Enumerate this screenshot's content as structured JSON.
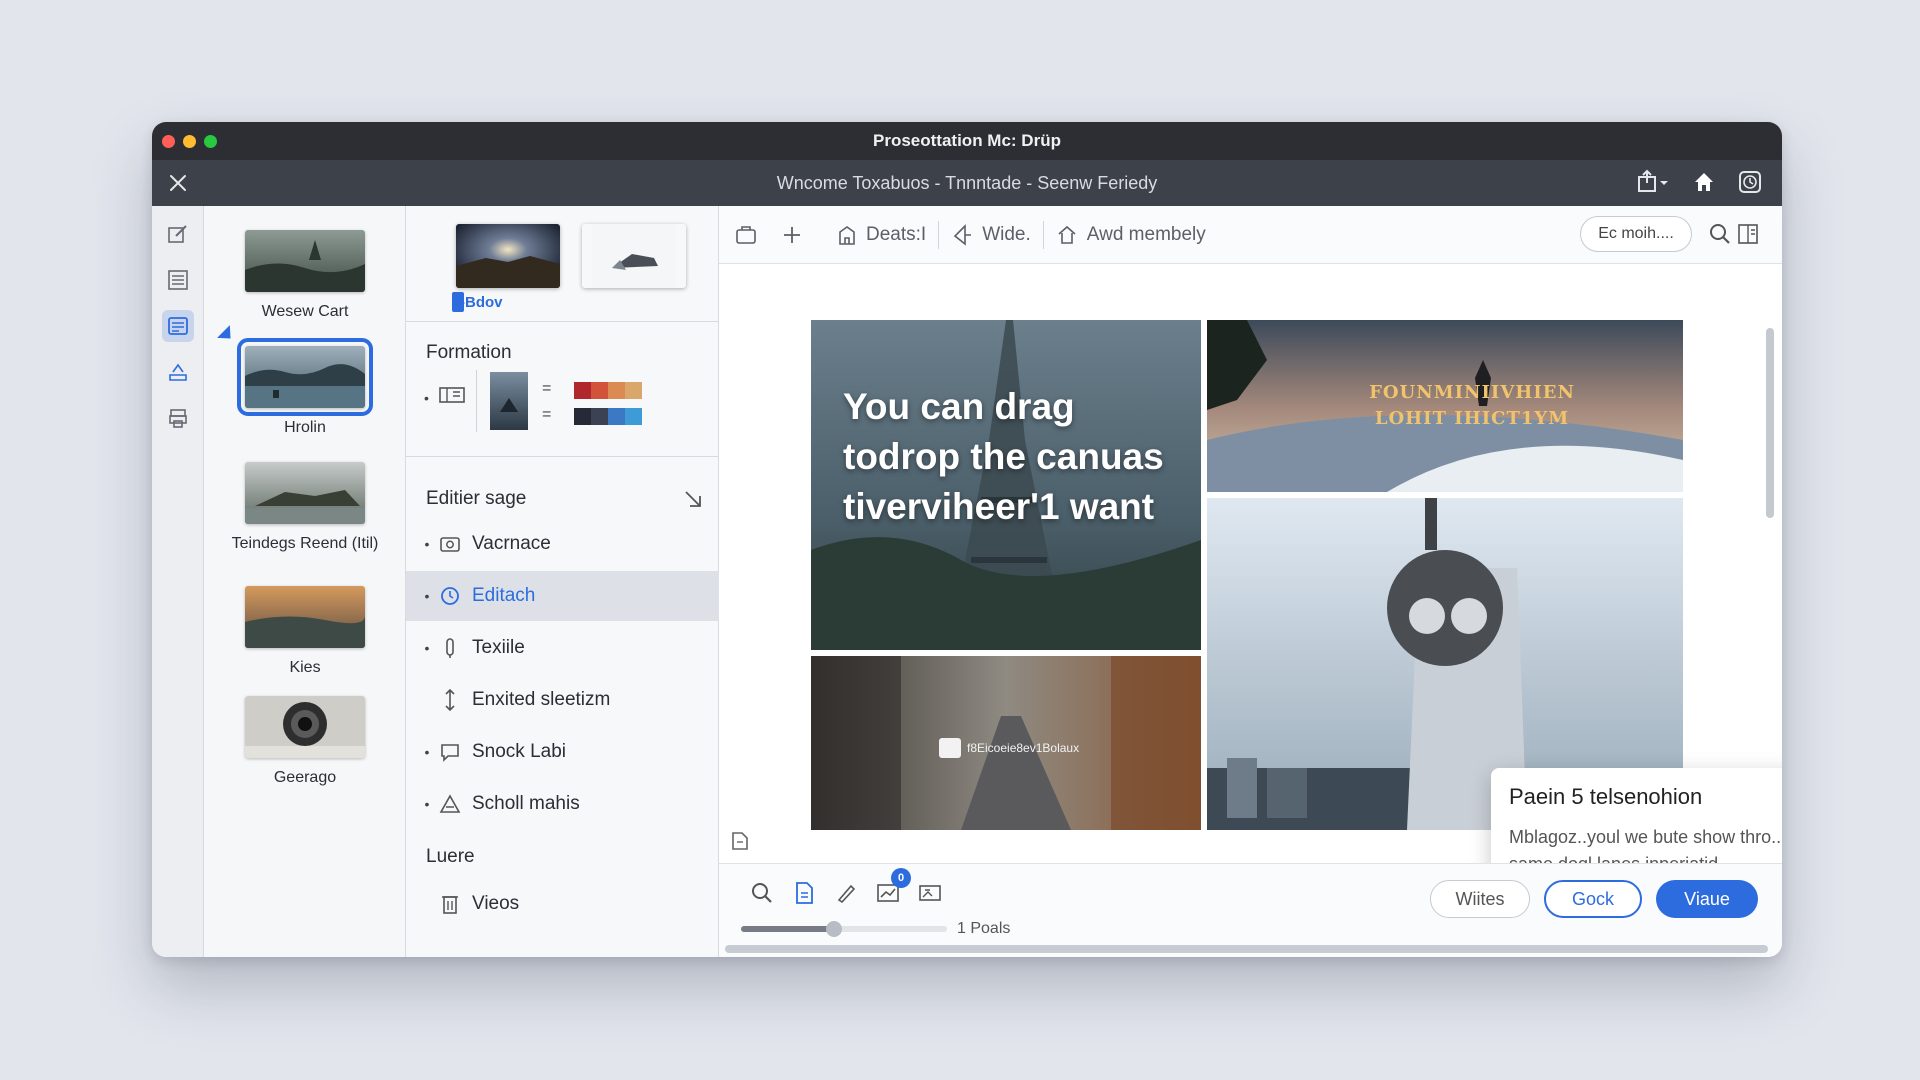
{
  "window": {
    "app_title": "Proseottation Mc: Drüp",
    "document_title": "Wncome Toxabuos - Tnnntade - Seenw Feriedy"
  },
  "slides": [
    {
      "label": "Wesew Cart"
    },
    {
      "label": "Hrolin"
    },
    {
      "label": "Teindegs Reend (Itil)"
    },
    {
      "label": "Kies"
    },
    {
      "label": "Geerago"
    }
  ],
  "panel": {
    "tag": "-Bdov",
    "formation_title": "Formation",
    "swatch_colors_warm": [
      "#b0282c",
      "#d2523a",
      "#db8a52",
      "#d9a66c"
    ],
    "swatch_colors_cool": [
      "#252a36",
      "#3b4254",
      "#3c79c4",
      "#3f9ad8"
    ],
    "editor_title": "Editier sage",
    "items": [
      {
        "label": "Vacrnace",
        "icon": "photo-frame-icon"
      },
      {
        "label": "Editach",
        "icon": "history-icon",
        "active": true
      },
      {
        "label": "Texiile",
        "icon": "pencil-icon"
      },
      {
        "label": "Enxited sleetizm",
        "icon": "vertical-resize-icon"
      },
      {
        "label": "Snock Labi",
        "icon": "comment-icon"
      },
      {
        "label": "Scholl mahis",
        "icon": "triangle-icon"
      }
    ],
    "luere_title": "Luere",
    "views_label": "Vieos"
  },
  "toolbar": {
    "deats_label": "Deats:I",
    "wide_label": "Wide.",
    "awd_label": "Awd membely",
    "search_value": "Ec moih...."
  },
  "canvas": {
    "headline": "You can drag todrop the canuas tiverviheer'1 want",
    "overlay_title": "FOUNMINIIVHIEN LOHIT IHICT1YM",
    "watermark": "f8Eicoeie8ev1Bolaux"
  },
  "popover": {
    "title": "Paein 5 telsenohion",
    "body": "Mblagoz..youl we bute show thro...white same doql lanes inperiatid."
  },
  "bottombar": {
    "badge_count": "0",
    "zoom_label": "1 Poals",
    "zoom_fraction": 0.45,
    "btn_wiites": "Wiites",
    "btn_gock": "Gock",
    "btn_viaue": "Viaue"
  },
  "colors": {
    "accent": "#2d6cdf",
    "titlebar": "#2c2e33",
    "docbar": "#3d4149"
  }
}
